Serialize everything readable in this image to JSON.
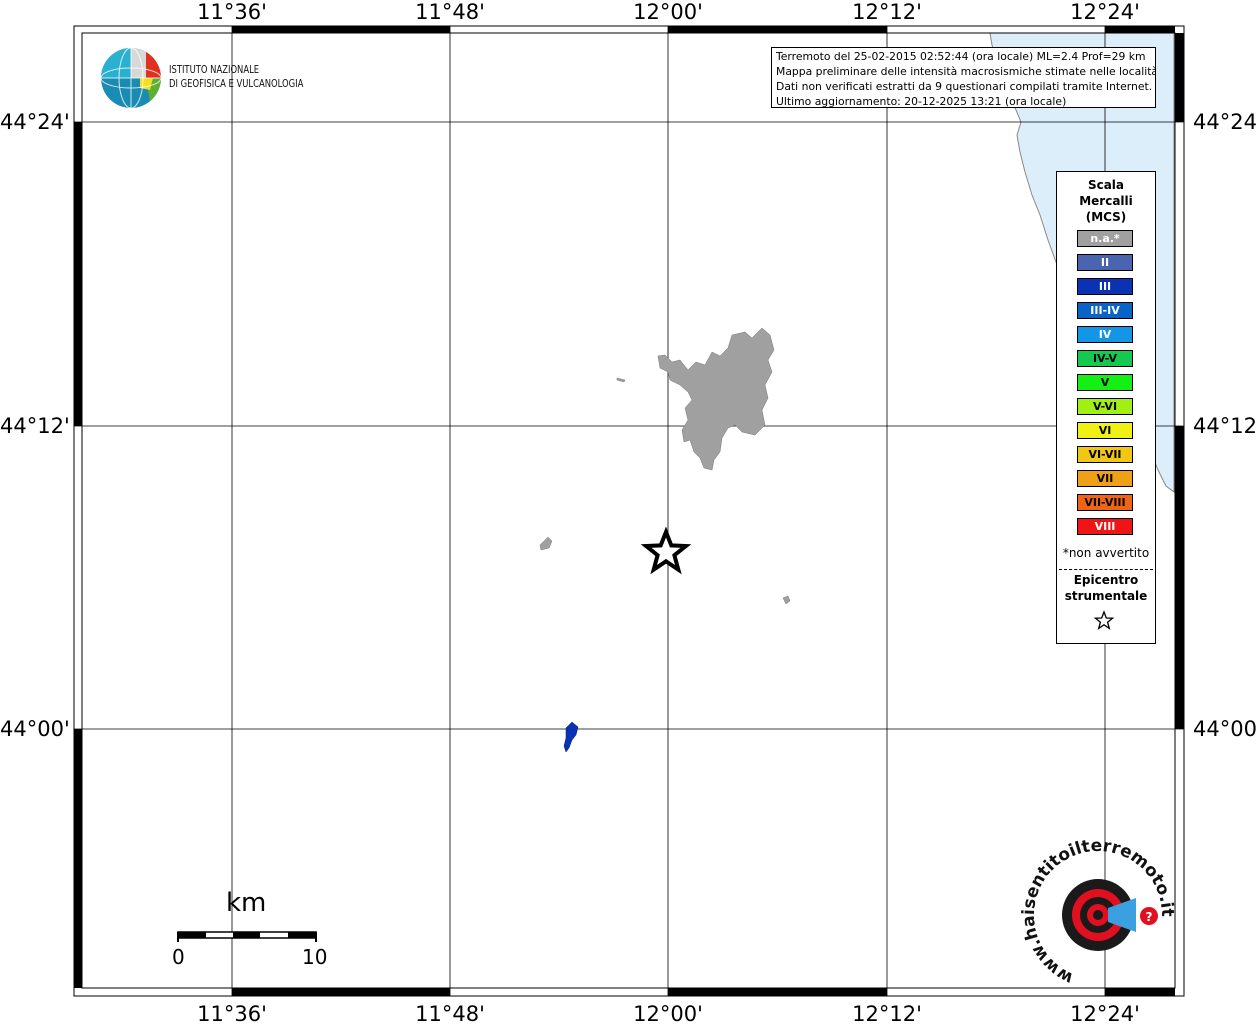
{
  "map": {
    "lon_ticks": [
      "11°36'",
      "11°48'",
      "12°00'",
      "12°12'",
      "12°24'"
    ],
    "lat_ticks": [
      "44°24'",
      "44°12'",
      "44°00'"
    ]
  },
  "logo": {
    "line1": "ISTITUTO NAZIONALE",
    "line2": "DI GEOFISICA E VULCANOLOGIA"
  },
  "info": {
    "line1": "Terremoto del 25-02-2015 02:52:44 (ora locale) ML=2.4 Prof=29 km",
    "line2": "Mappa preliminare delle intensità macrosismiche stimate nelle località",
    "line3": "Dati non verificati estratti da 9 questionari compilati tramite Internet.",
    "line4": "Ultimo aggiornamento: 20-12-2025 13:21 (ora locale)"
  },
  "legend": {
    "title1": "Scala",
    "title2": "Mercalli",
    "title3": "(MCS)",
    "classes": [
      {
        "label": "n.a.*",
        "color": "#a0a0a0"
      },
      {
        "label": "II",
        "color": "#4a64b0"
      },
      {
        "label": "III",
        "color": "#0a32b4"
      },
      {
        "label": "III-IV",
        "color": "#0a64c8"
      },
      {
        "label": "IV",
        "color": "#1496e6"
      },
      {
        "label": "IV-V",
        "color": "#14c850"
      },
      {
        "label": "V",
        "color": "#14f014"
      },
      {
        "label": "V-VI",
        "color": "#a0f014"
      },
      {
        "label": "VI",
        "color": "#f0f014"
      },
      {
        "label": "VI-VII",
        "color": "#f0c814"
      },
      {
        "label": "VII",
        "color": "#f0a014"
      },
      {
        "label": "VII-VIII",
        "color": "#f06414"
      },
      {
        "label": "VIII",
        "color": "#f01414"
      }
    ],
    "note": "*non avvertito",
    "epicenter1": "Epicentro",
    "epicenter2": "strumentale"
  },
  "scalebar": {
    "unit": "km",
    "start": "0",
    "end": "10"
  },
  "badge": {
    "text": "www.haisentitoilterremoto.it"
  },
  "colors": {
    "sea": "#ddeefb",
    "area_na": "#a0a0a0",
    "area_iii": "#0a32b4"
  }
}
